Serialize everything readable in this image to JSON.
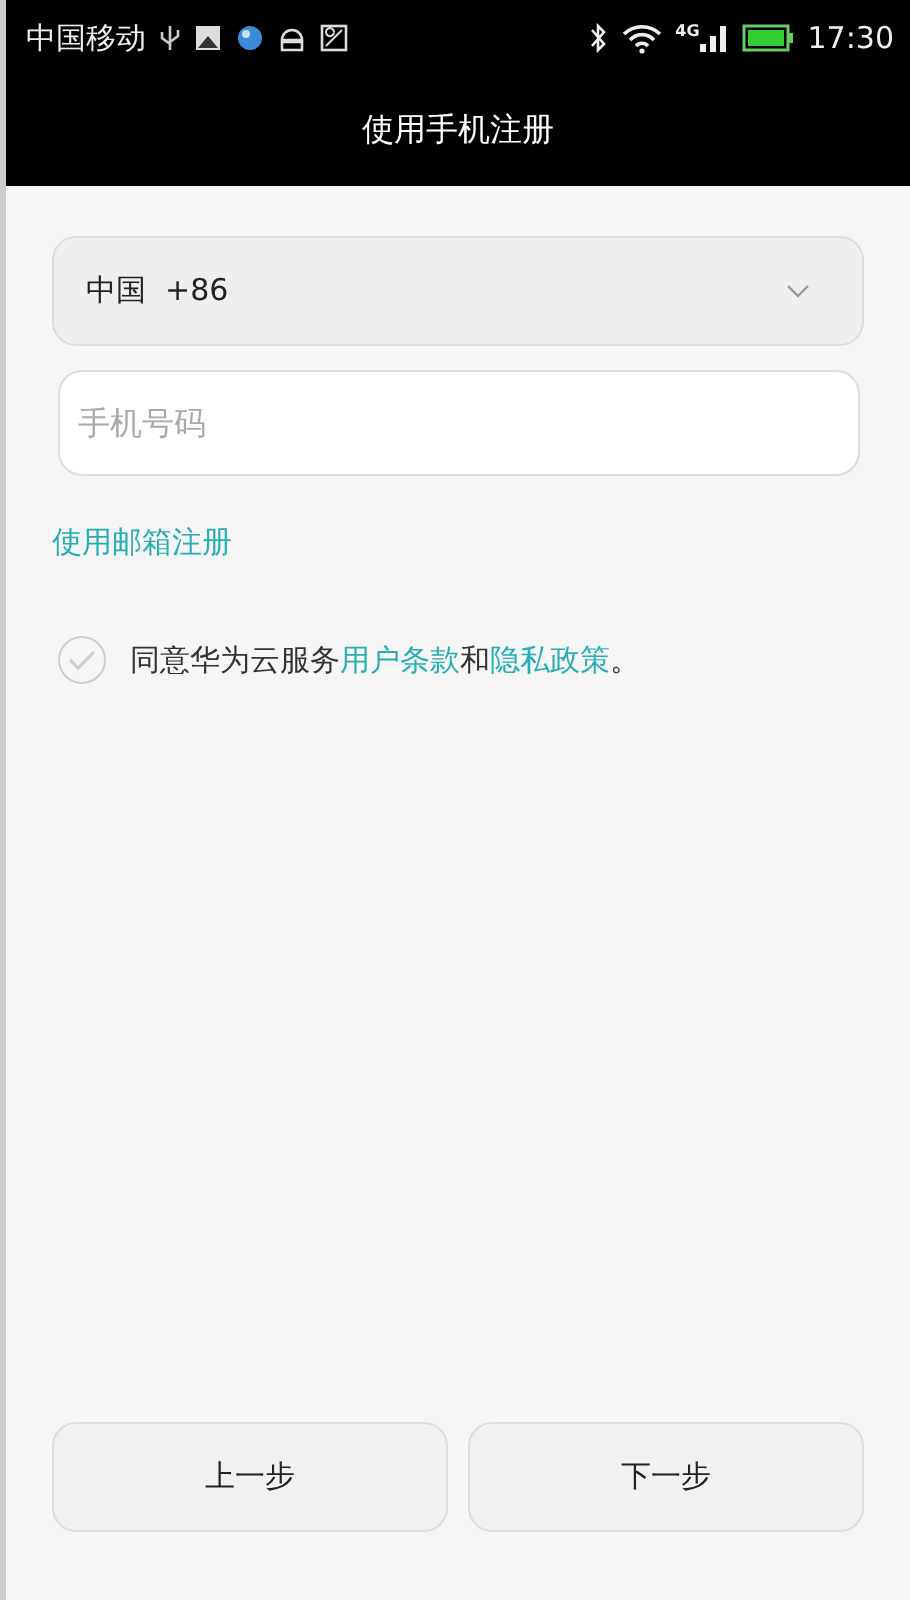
{
  "status_bar": {
    "carrier": "中国移动",
    "network": "4G",
    "time": "17:30"
  },
  "title": "使用手机注册",
  "country": {
    "value": "中国  +86"
  },
  "phone": {
    "placeholder": "手机号码"
  },
  "email_link": "使用邮箱注册",
  "agreement": {
    "checked": false,
    "parts": [
      {
        "kind": "text",
        "text": "同意华为云服务"
      },
      {
        "kind": "link",
        "text": "用户条款"
      },
      {
        "kind": "text",
        "text": "和"
      },
      {
        "kind": "link",
        "text": "隐私政策"
      },
      {
        "kind": "text",
        "text": "。"
      }
    ]
  },
  "buttons": [
    "上一步",
    "下一步"
  ]
}
